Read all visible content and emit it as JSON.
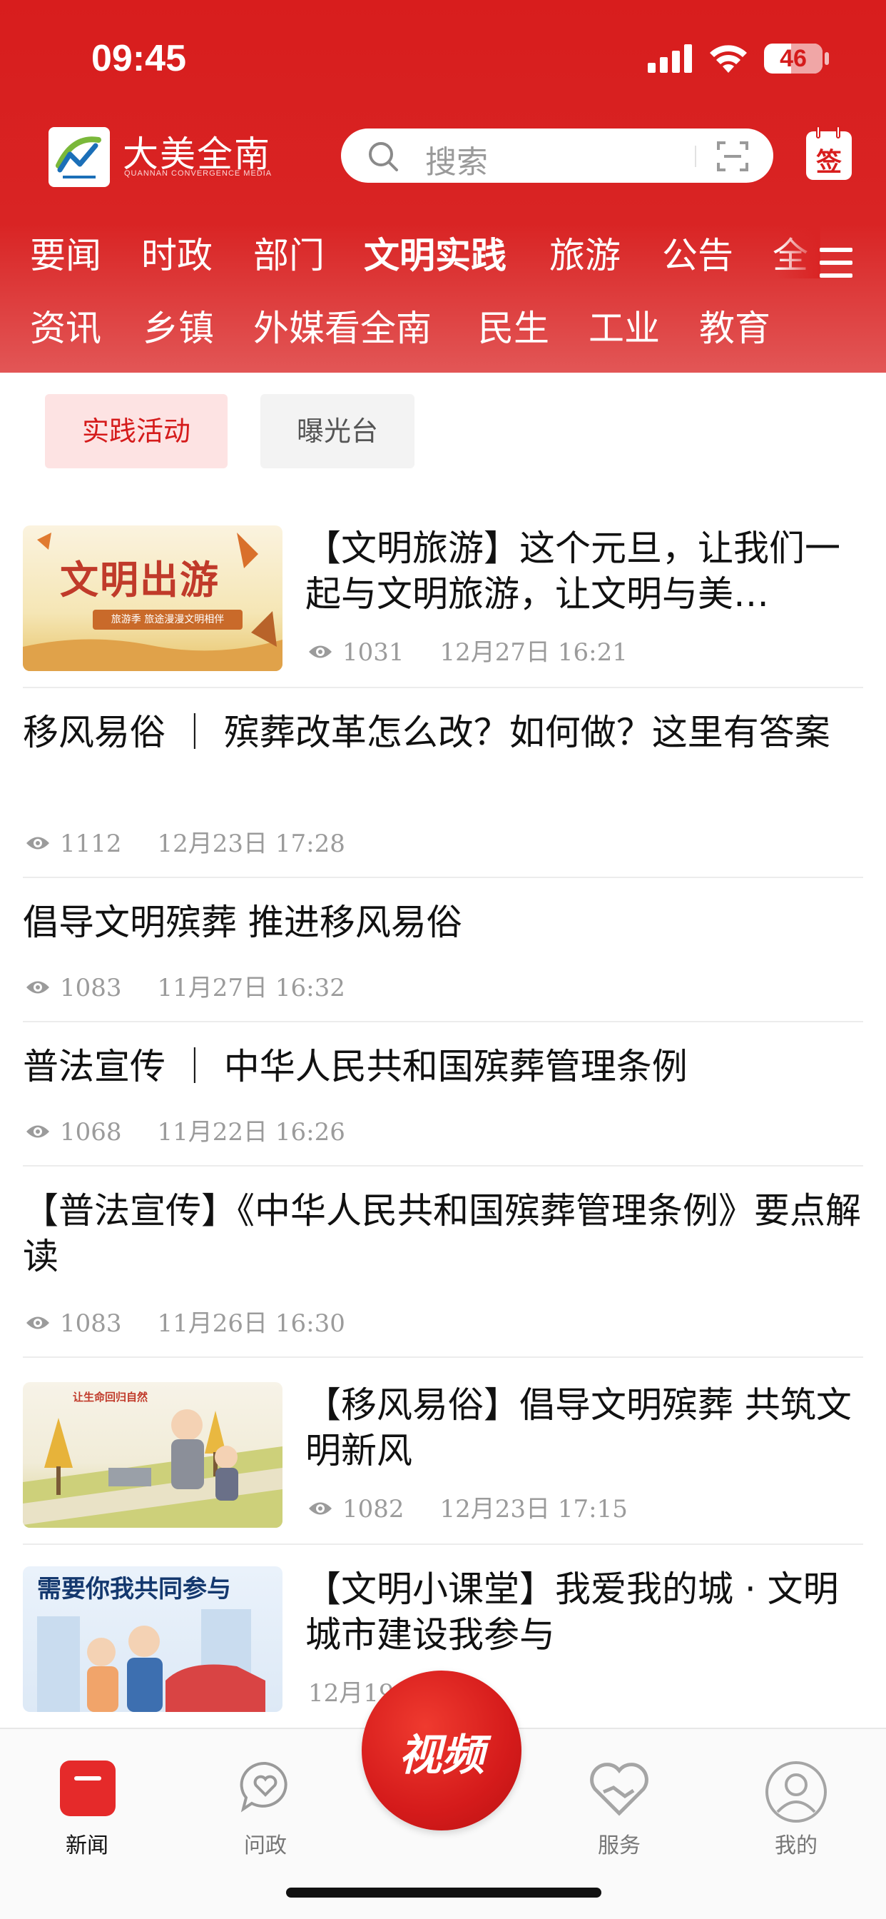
{
  "status_bar": {
    "time": "09:45",
    "battery": "46",
    "battery_level": 0.46
  },
  "header": {
    "logo_title": "大美全南",
    "logo_subtitle": "QUANNAN CONVERGENCE MEDIA",
    "search_placeholder": "搜索",
    "signin_label": "签"
  },
  "nav": {
    "row1": [
      "要闻",
      "时政",
      "部门",
      "文明实践",
      "旅游",
      "公告",
      "全"
    ],
    "row2": [
      "资讯",
      "乡镇",
      "外媒看全南",
      "民生",
      "工业",
      "教育"
    ],
    "active": "文明实践"
  },
  "subtabs": [
    "实践活动",
    "曝光台"
  ],
  "articles": [
    {
      "title": "【文明旅游】这个元旦，让我们一起与文明旅游，让文明与美…",
      "views": "1031",
      "date": "12月27日  16:21",
      "thumb_text": "文明出游",
      "thumb_banner": "旅游季 旅途漫漫文明相伴"
    },
    {
      "title": "移风易俗 ｜ 殡葬改革怎么改？如何做？这里有答案",
      "views": "1112",
      "date": "12月23日  17:28"
    },
    {
      "title": "倡导文明殡葬  推进移风易俗",
      "views": "1083",
      "date": "11月27日  16:32"
    },
    {
      "title": "普法宣传 ｜ 中华人民共和国殡葬管理条例",
      "views": "1068",
      "date": "11月22日  16:26"
    },
    {
      "title": "【普法宣传】《中华人民共和国殡葬管理条例》要点解读",
      "views": "1083",
      "date": "11月26日  16:30"
    },
    {
      "title": "【移风易俗】倡导文明殡葬  共筑文明新风",
      "views": "1082",
      "date": "12月23日  17:15",
      "thumb_text": "让生命回归自然"
    },
    {
      "title": "【文明小课堂】我爱我的城 · 文明城市建设我参与",
      "date_partial": "12月19",
      "thumb_text": "需要你我共同参与"
    }
  ],
  "tabbar": {
    "items": [
      "新闻",
      "问政",
      "服务",
      "我的"
    ],
    "video_label": "视频"
  }
}
